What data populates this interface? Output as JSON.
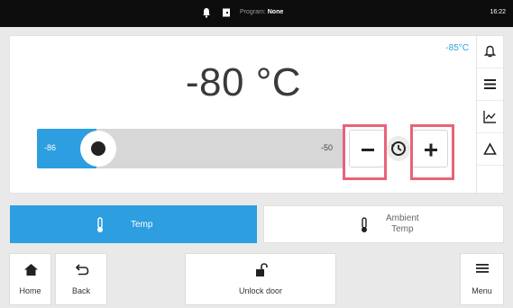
{
  "status_bar": {
    "program_label": "Program:",
    "program_value": "None",
    "time": "16:22",
    "icons": [
      "bell-icon",
      "door-icon"
    ]
  },
  "display": {
    "ambient_temp": "-85°C",
    "setpoint": "-80 °C"
  },
  "slider": {
    "min_label": "-86",
    "max_label": "-50",
    "level_fraction": 0.17
  },
  "controls": {
    "minus": "−",
    "plus": "+",
    "reset_icon": "history-icon"
  },
  "sidebar": {
    "items": [
      "bell-icon",
      "list-icon",
      "chart-icon",
      "delta-icon"
    ]
  },
  "tabs": [
    {
      "label": "Temp",
      "icon": "thermometer-icon",
      "active": true
    },
    {
      "label_line1": "Ambient",
      "label_line2": "Temp",
      "icon": "thermometer-icon",
      "active": false
    }
  ],
  "bottom_bar": {
    "home": "Home",
    "back": "Back",
    "unlock": "Unlock door",
    "menu": "Menu"
  },
  "colors": {
    "accent": "#2d9ee0",
    "highlight": "#e8637a",
    "status_bar": "#0d0d0d"
  }
}
